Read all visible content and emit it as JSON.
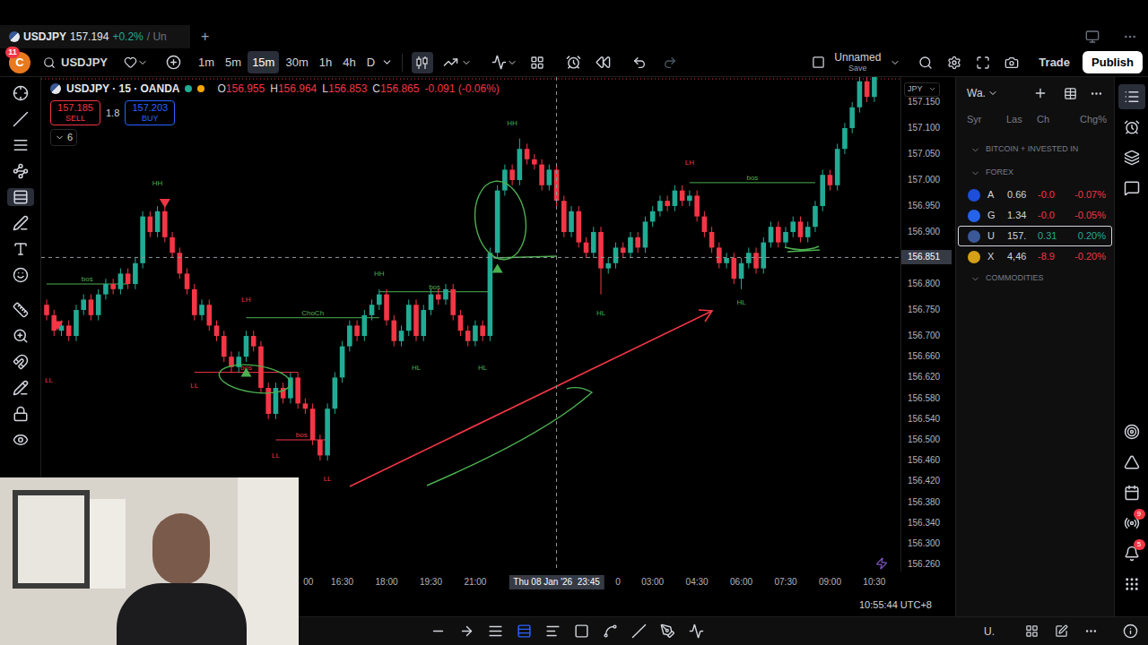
{
  "tab": {
    "symbol": "USDJPY",
    "price": "157.194",
    "change": "+0.2%",
    "suffix": "/ Un",
    "add": "+"
  },
  "toolbar": {
    "avatar": "C",
    "badge": "11",
    "search": "USDJPY",
    "intervals": [
      {
        "label": "1m",
        "selected": false
      },
      {
        "label": "5m",
        "selected": false
      },
      {
        "label": "15m",
        "selected": true
      },
      {
        "label": "30m",
        "selected": false
      },
      {
        "label": "1h",
        "selected": false
      },
      {
        "label": "4h",
        "selected": false
      },
      {
        "label": "D",
        "selected": false
      }
    ],
    "chart_styles": [
      {
        "selected": true
      },
      {
        "selected": false
      }
    ],
    "layout": {
      "name": "Unnamed",
      "status": "Save"
    },
    "trade": "Trade",
    "publish": "Publish"
  },
  "left_tools": [
    {
      "selected": false
    },
    {
      "selected": false
    },
    {
      "selected": false
    },
    {
      "selected": false
    },
    {
      "selected": true
    },
    {
      "selected": false
    },
    {
      "selected": false
    },
    {
      "selected": false
    },
    {
      "selected": false
    },
    {
      "selected": false
    },
    {
      "selected": false
    },
    {
      "selected": false
    },
    {
      "selected": false
    },
    {
      "selected": false
    }
  ],
  "legend": {
    "symbol": "USDJPY · 15 · OANDA",
    "ohlc": [
      {
        "key": "O",
        "value": "156.955"
      },
      {
        "key": "H",
        "value": "156.964"
      },
      {
        "key": "L",
        "value": "156.853"
      },
      {
        "key": "C",
        "value": "156.865"
      }
    ],
    "change": "-0.091 (-0.06%)",
    "sell": {
      "price": "157.185",
      "label": "SELL"
    },
    "spread": "1.8",
    "buy": {
      "price": "157.203",
      "label": "BUY"
    },
    "indicators": "6"
  },
  "chart": {
    "currency": "JPY",
    "price_ticks": [
      "157.150",
      "157.100",
      "157.050",
      "157.000",
      "156.950",
      "156.900",
      "156.800",
      "156.750",
      "156.700",
      "156.660",
      "156.620",
      "156.580",
      "156.540",
      "156.500",
      "156.460",
      "156.420",
      "156.380",
      "156.340",
      "156.300",
      "156.260"
    ],
    "crosshair": {
      "price": "156.851",
      "value": 156.851,
      "time": "Thu 08 Jan '26  23:45",
      "index": 69
    },
    "time_ticks": [
      {
        "label": "00",
        "index": 35.4
      },
      {
        "label": "16:30",
        "index": 40
      },
      {
        "label": "18:00",
        "index": 46
      },
      {
        "label": "19:30",
        "index": 52
      },
      {
        "label": "21:00",
        "index": 58
      },
      {
        "label": "0",
        "index": 77.3
      },
      {
        "label": "03:00",
        "index": 82
      },
      {
        "label": "04:30",
        "index": 88
      },
      {
        "label": "06:00",
        "index": 94
      },
      {
        "label": "07:30",
        "index": 100
      },
      {
        "label": "09:00",
        "index": 106
      },
      {
        "label": "10:30",
        "index": 112
      }
    ],
    "candles": [
      [
        156.76,
        156.77,
        156.73,
        156.74
      ],
      [
        156.74,
        156.75,
        156.7,
        156.71
      ],
      [
        156.71,
        156.73,
        156.7,
        156.72
      ],
      [
        156.72,
        156.73,
        156.69,
        156.7
      ],
      [
        156.7,
        156.76,
        156.69,
        156.75
      ],
      [
        156.75,
        156.78,
        156.74,
        156.77
      ],
      [
        156.77,
        156.78,
        156.73,
        156.74
      ],
      [
        156.74,
        156.79,
        156.73,
        156.78
      ],
      [
        156.78,
        156.81,
        156.77,
        156.8
      ],
      [
        156.8,
        156.81,
        156.78,
        156.79
      ],
      [
        156.79,
        156.83,
        156.78,
        156.82
      ],
      [
        156.82,
        156.83,
        156.79,
        156.8
      ],
      [
        156.8,
        156.85,
        156.79,
        156.84
      ],
      [
        156.84,
        156.94,
        156.83,
        156.93
      ],
      [
        156.93,
        156.94,
        156.89,
        156.9
      ],
      [
        156.9,
        156.95,
        156.89,
        156.94
      ],
      [
        156.94,
        156.95,
        156.88,
        156.89
      ],
      [
        156.89,
        156.9,
        156.85,
        156.86
      ],
      [
        156.86,
        156.87,
        156.81,
        156.82
      ],
      [
        156.82,
        156.83,
        156.78,
        156.79
      ],
      [
        156.79,
        156.8,
        156.73,
        156.74
      ],
      [
        156.74,
        156.77,
        156.73,
        156.76
      ],
      [
        156.76,
        156.77,
        156.71,
        156.72
      ],
      [
        156.72,
        156.73,
        156.69,
        156.7
      ],
      [
        156.7,
        156.71,
        156.65,
        156.66
      ],
      [
        156.66,
        156.67,
        156.63,
        156.64
      ],
      [
        156.64,
        156.67,
        156.63,
        156.66
      ],
      [
        156.66,
        156.71,
        156.65,
        156.7
      ],
      [
        156.7,
        156.71,
        156.67,
        156.68
      ],
      [
        156.68,
        156.69,
        156.59,
        156.6
      ],
      [
        156.6,
        156.61,
        156.54,
        156.55
      ],
      [
        156.55,
        156.61,
        156.54,
        156.6
      ],
      [
        156.6,
        156.61,
        156.57,
        156.58
      ],
      [
        156.58,
        156.63,
        156.57,
        156.62
      ],
      [
        156.62,
        156.63,
        156.56,
        156.57
      ],
      [
        156.57,
        156.58,
        156.55,
        156.56
      ],
      [
        156.56,
        156.57,
        156.49,
        156.5
      ],
      [
        156.5,
        156.51,
        156.46,
        156.47
      ],
      [
        156.47,
        156.57,
        156.46,
        156.56
      ],
      [
        156.56,
        156.63,
        156.55,
        156.62
      ],
      [
        156.62,
        156.69,
        156.61,
        156.68
      ],
      [
        156.68,
        156.73,
        156.67,
        156.72
      ],
      [
        156.72,
        156.73,
        156.69,
        156.7
      ],
      [
        156.7,
        156.75,
        156.69,
        156.74
      ],
      [
        156.74,
        156.77,
        156.73,
        156.76
      ],
      [
        156.76,
        156.79,
        156.75,
        156.78
      ],
      [
        156.78,
        156.79,
        156.72,
        156.73
      ],
      [
        156.73,
        156.74,
        156.68,
        156.69
      ],
      [
        156.69,
        156.72,
        156.68,
        156.71
      ],
      [
        156.71,
        156.77,
        156.7,
        156.76
      ],
      [
        156.76,
        156.77,
        156.69,
        156.7
      ],
      [
        156.7,
        156.76,
        156.69,
        156.75
      ],
      [
        156.75,
        156.79,
        156.74,
        156.78
      ],
      [
        156.78,
        156.79,
        156.76,
        156.77
      ],
      [
        156.77,
        156.8,
        156.76,
        156.79
      ],
      [
        156.79,
        156.8,
        156.73,
        156.74
      ],
      [
        156.74,
        156.75,
        156.7,
        156.71
      ],
      [
        156.71,
        156.72,
        156.68,
        156.69
      ],
      [
        156.69,
        156.73,
        156.68,
        156.72
      ],
      [
        156.72,
        156.73,
        156.69,
        156.7
      ],
      [
        156.7,
        156.87,
        156.69,
        156.86
      ],
      [
        156.86,
        156.99,
        156.85,
        156.98
      ],
      [
        156.98,
        157.03,
        156.97,
        157.02
      ],
      [
        157.02,
        157.03,
        156.99,
        157.0
      ],
      [
        157.0,
        157.08,
        156.99,
        157.06
      ],
      [
        157.06,
        157.07,
        157.03,
        157.04
      ],
      [
        157.04,
        157.05,
        157.02,
        157.03
      ],
      [
        157.03,
        157.04,
        156.98,
        156.99
      ],
      [
        156.99,
        157.03,
        156.98,
        157.02
      ],
      [
        157.02,
        157.03,
        156.95,
        156.96
      ],
      [
        156.96,
        156.97,
        156.89,
        156.9
      ],
      [
        156.9,
        156.95,
        156.89,
        156.94
      ],
      [
        156.94,
        156.95,
        156.87,
        156.88
      ],
      [
        156.88,
        156.89,
        156.85,
        156.86
      ],
      [
        156.86,
        156.91,
        156.85,
        156.9
      ],
      [
        156.9,
        156.91,
        156.78,
        156.83
      ],
      [
        156.83,
        156.85,
        156.82,
        156.84
      ],
      [
        156.84,
        156.88,
        156.83,
        156.87
      ],
      [
        156.87,
        156.88,
        156.85,
        156.86
      ],
      [
        156.86,
        156.9,
        156.85,
        156.89
      ],
      [
        156.89,
        156.9,
        156.86,
        156.87
      ],
      [
        156.87,
        156.93,
        156.86,
        156.92
      ],
      [
        156.92,
        156.95,
        156.91,
        156.94
      ],
      [
        156.94,
        156.97,
        156.93,
        156.96
      ],
      [
        156.96,
        156.97,
        156.94,
        156.95
      ],
      [
        156.95,
        156.99,
        156.94,
        156.98
      ],
      [
        156.98,
        156.99,
        156.95,
        156.96
      ],
      [
        156.96,
        156.98,
        156.95,
        156.97
      ],
      [
        156.97,
        156.98,
        156.92,
        156.93
      ],
      [
        156.93,
        156.94,
        156.89,
        156.9
      ],
      [
        156.9,
        156.91,
        156.86,
        156.87
      ],
      [
        156.87,
        156.88,
        156.83,
        156.84
      ],
      [
        156.84,
        156.86,
        156.83,
        156.85
      ],
      [
        156.85,
        156.86,
        156.8,
        156.81
      ],
      [
        156.81,
        156.85,
        156.79,
        156.84
      ],
      [
        156.84,
        156.87,
        156.83,
        156.86
      ],
      [
        156.86,
        156.87,
        156.82,
        156.83
      ],
      [
        156.83,
        156.89,
        156.82,
        156.88
      ],
      [
        156.88,
        156.92,
        156.87,
        156.91
      ],
      [
        156.91,
        156.92,
        156.87,
        156.88
      ],
      [
        156.88,
        156.91,
        156.87,
        156.9
      ],
      [
        156.9,
        156.93,
        156.89,
        156.92
      ],
      [
        156.92,
        156.93,
        156.88,
        156.89
      ],
      [
        156.89,
        156.92,
        156.88,
        156.91
      ],
      [
        156.91,
        156.96,
        156.9,
        156.95
      ],
      [
        156.95,
        157.02,
        156.94,
        157.01
      ],
      [
        157.01,
        157.02,
        156.98,
        156.99
      ],
      [
        156.99,
        157.07,
        156.98,
        157.06
      ],
      [
        157.06,
        157.11,
        157.05,
        157.1
      ],
      [
        157.1,
        157.15,
        157.09,
        157.14
      ],
      [
        157.14,
        157.2,
        157.13,
        157.19
      ],
      [
        157.19,
        157.2,
        157.15,
        157.16
      ],
      [
        157.16,
        157.21,
        157.15,
        157.2
      ]
    ],
    "labels": [
      {
        "text": "HH",
        "index": 15,
        "price": 156.99,
        "color": "#4caf50"
      },
      {
        "text": "LL",
        "index": 0.3,
        "price": 156.61,
        "color": "#f23645"
      },
      {
        "text": "LH",
        "index": 27,
        "price": 156.765,
        "color": "#f23645"
      },
      {
        "text": "LL",
        "index": 20,
        "price": 156.6,
        "color": "#f23645"
      },
      {
        "text": "LL",
        "index": 31,
        "price": 156.465,
        "color": "#f23645"
      },
      {
        "text": "LL",
        "index": 38,
        "price": 156.42,
        "color": "#f23645"
      },
      {
        "text": "HH",
        "index": 45,
        "price": 156.815,
        "color": "#4caf50"
      },
      {
        "text": "HL",
        "index": 50,
        "price": 156.635,
        "color": "#4caf50"
      },
      {
        "text": "HL",
        "index": 59,
        "price": 156.635,
        "color": "#4caf50"
      },
      {
        "text": "HH",
        "index": 63,
        "price": 157.105,
        "color": "#4caf50"
      },
      {
        "text": "HL",
        "index": 75,
        "price": 156.74,
        "color": "#4caf50"
      },
      {
        "text": "LH",
        "index": 87,
        "price": 157.03,
        "color": "#f23645"
      },
      {
        "text": "HL",
        "index": 94,
        "price": 156.76,
        "color": "#4caf50"
      }
    ],
    "structure": [
      {
        "text": "bos",
        "from": 0,
        "to": 11,
        "price": 156.8,
        "color": "#4caf50"
      },
      {
        "text": "bos",
        "from": 20,
        "to": 34,
        "price": 156.63,
        "color": "#f23645"
      },
      {
        "text": "ChoCh",
        "from": 27,
        "to": 45,
        "price": 156.735,
        "color": "#4caf50"
      },
      {
        "text": "bos",
        "from": 31,
        "to": 38,
        "price": 156.5,
        "color": "#f23645"
      },
      {
        "text": "bos",
        "from": 45,
        "to": 60,
        "price": 156.785,
        "color": "#4caf50"
      },
      {
        "text": "bos",
        "from": 87,
        "to": 104,
        "price": 156.995,
        "color": "#4caf50"
      }
    ],
    "markers": [
      {
        "kind": "down",
        "index": 16,
        "price": 156.955,
        "color": "#f23645"
      },
      {
        "kind": "down",
        "index": 1.5,
        "price": 156.72,
        "color": "#f23645"
      },
      {
        "kind": "up",
        "index": 27,
        "price": 156.63,
        "color": "#4caf50"
      },
      {
        "kind": "up",
        "index": 61,
        "price": 156.83,
        "color": "#4caf50"
      }
    ],
    "clock": "10:55:44 UTC+8"
  },
  "watchlist": {
    "title": "Wa.",
    "columns": [
      "Syr",
      "Las",
      "Ch",
      "Chg%"
    ],
    "groups": [
      {
        "name": "BITCOIN + INVESTED IN",
        "expanded": true,
        "items": []
      },
      {
        "name": "FOREX",
        "expanded": true,
        "items": [
          {
            "symbol": "A",
            "last": "0.66",
            "change": "-0.0",
            "percent": "-0.07%",
            "trend": "down",
            "selected": false,
            "color": "#1d4ed8"
          },
          {
            "symbol": "G",
            "last": "1.34",
            "change": "-0.0",
            "percent": "-0.05%",
            "trend": "down",
            "selected": false,
            "color": "#2563eb"
          },
          {
            "symbol": "U",
            "last": "157.",
            "change": "0.31",
            "percent": "0.20%",
            "trend": "up",
            "selected": true,
            "color": "#3b5998"
          },
          {
            "symbol": "X",
            "last": "4,46",
            "change": "-8.9",
            "percent": "-0.20%",
            "trend": "down",
            "selected": false,
            "color": "#d4a017"
          }
        ]
      },
      {
        "name": "COMMODITIES",
        "expanded": true,
        "items": []
      }
    ]
  },
  "right_tools": [
    {
      "selected": true,
      "badge": ""
    },
    {
      "selected": false,
      "badge": ""
    },
    {
      "selected": false,
      "badge": ""
    },
    {
      "selected": false,
      "badge": ""
    },
    {
      "selected": false,
      "badge": ""
    },
    {
      "selected": false,
      "badge": ""
    },
    {
      "selected": false,
      "badge": ""
    },
    {
      "selected": false,
      "badge": "9"
    },
    {
      "selected": false,
      "badge": "5"
    },
    {
      "selected": false,
      "badge": ""
    }
  ],
  "bottom": {
    "account": "U."
  }
}
